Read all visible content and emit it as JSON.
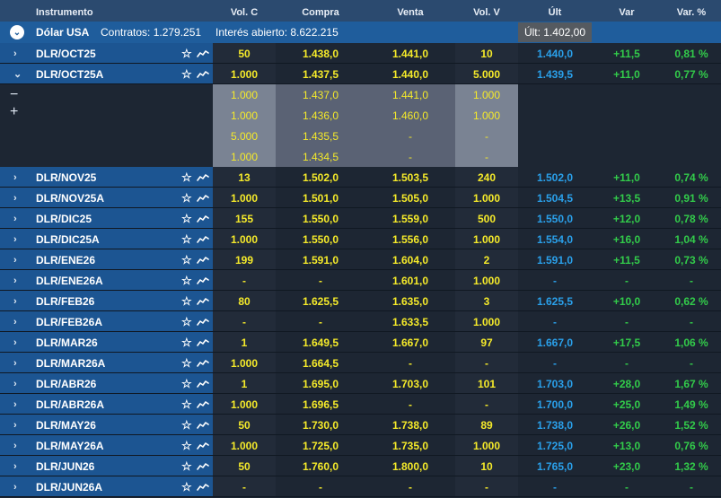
{
  "columns": {
    "instrument": "Instrumento",
    "vol_c": "Vol. C",
    "compra": "Compra",
    "venta": "Venta",
    "vol_v": "Vol. V",
    "ult": "Últ",
    "var": "Var",
    "var_pct": "Var. %"
  },
  "group": {
    "title": "Dólar USA",
    "contracts": "Contratos: 1.279.251",
    "open_interest": "Interés abierto: 8.622.215",
    "ult": "Últ: 1.402,00"
  },
  "icons": {
    "expand_group": "chevron-down-circle-icon",
    "row_expand": "chevron-right-icon",
    "row_collapse": "chevron-down-icon",
    "favorite": "star-icon",
    "chart": "trend-chart-icon",
    "depth_minus": "minus-icon",
    "depth_plus": "plus-icon"
  },
  "colors": {
    "header_bg": "#2b4a6f",
    "group_bg": "#1f5d9c",
    "row_bg": "#1c5592",
    "yellow": "#f5ea2a",
    "blue": "#2aa0ea",
    "green": "#32cb4a"
  },
  "rows_before_depth": [
    {
      "name": "DLR/OCT25",
      "chev": "›",
      "vol_c": "50",
      "compra": "1.438,0",
      "venta": "1.441,0",
      "vol_v": "10",
      "ult": "1.440,0",
      "var": "+11,5",
      "var_pct": "0,81 %"
    },
    {
      "name": "DLR/OCT25A",
      "chev": "⌄",
      "vol_c": "1.000",
      "compra": "1.437,5",
      "venta": "1.440,0",
      "vol_v": "5.000",
      "ult": "1.439,5",
      "var": "+11,0",
      "var_pct": "0,77 %"
    }
  ],
  "depth": {
    "minus": "−",
    "plus": "+",
    "rows": [
      {
        "vol_c": "1.000",
        "compra": "1.437,0",
        "venta": "1.441,0",
        "vol_v": "1.000"
      },
      {
        "vol_c": "1.000",
        "compra": "1.436,0",
        "venta": "1.460,0",
        "vol_v": "1.000"
      },
      {
        "vol_c": "5.000",
        "compra": "1.435,5",
        "venta": "-",
        "vol_v": "-"
      },
      {
        "vol_c": "1.000",
        "compra": "1.434,5",
        "venta": "-",
        "vol_v": "-"
      }
    ]
  },
  "rows_after_depth": [
    {
      "name": "DLR/NOV25",
      "chev": "›",
      "vol_c": "13",
      "compra": "1.502,0",
      "venta": "1.503,5",
      "vol_v": "240",
      "ult": "1.502,0",
      "var": "+11,0",
      "var_pct": "0,74 %"
    },
    {
      "name": "DLR/NOV25A",
      "chev": "›",
      "vol_c": "1.000",
      "compra": "1.501,0",
      "venta": "1.505,0",
      "vol_v": "1.000",
      "ult": "1.504,5",
      "var": "+13,5",
      "var_pct": "0,91 %"
    },
    {
      "name": "DLR/DIC25",
      "chev": "›",
      "vol_c": "155",
      "compra": "1.550,0",
      "venta": "1.559,0",
      "vol_v": "500",
      "ult": "1.550,0",
      "var": "+12,0",
      "var_pct": "0,78 %"
    },
    {
      "name": "DLR/DIC25A",
      "chev": "›",
      "vol_c": "1.000",
      "compra": "1.550,0",
      "venta": "1.556,0",
      "vol_v": "1.000",
      "ult": "1.554,0",
      "var": "+16,0",
      "var_pct": "1,04 %"
    },
    {
      "name": "DLR/ENE26",
      "chev": "›",
      "vol_c": "199",
      "compra": "1.591,0",
      "venta": "1.604,0",
      "vol_v": "2",
      "ult": "1.591,0",
      "var": "+11,5",
      "var_pct": "0,73 %"
    },
    {
      "name": "DLR/ENE26A",
      "chev": "›",
      "vol_c": "-",
      "compra": "-",
      "venta": "1.601,0",
      "vol_v": "1.000",
      "ult": "-",
      "var": "-",
      "var_pct": "-"
    },
    {
      "name": "DLR/FEB26",
      "chev": "›",
      "vol_c": "80",
      "compra": "1.625,5",
      "venta": "1.635,0",
      "vol_v": "3",
      "ult": "1.625,5",
      "var": "+10,0",
      "var_pct": "0,62 %"
    },
    {
      "name": "DLR/FEB26A",
      "chev": "›",
      "vol_c": "-",
      "compra": "-",
      "venta": "1.633,5",
      "vol_v": "1.000",
      "ult": "-",
      "var": "-",
      "var_pct": "-"
    },
    {
      "name": "DLR/MAR26",
      "chev": "›",
      "vol_c": "1",
      "compra": "1.649,5",
      "venta": "1.667,0",
      "vol_v": "97",
      "ult": "1.667,0",
      "var": "+17,5",
      "var_pct": "1,06 %"
    },
    {
      "name": "DLR/MAR26A",
      "chev": "›",
      "vol_c": "1.000",
      "compra": "1.664,5",
      "venta": "-",
      "vol_v": "-",
      "ult": "-",
      "var": "-",
      "var_pct": "-"
    },
    {
      "name": "DLR/ABR26",
      "chev": "›",
      "vol_c": "1",
      "compra": "1.695,0",
      "venta": "1.703,0",
      "vol_v": "101",
      "ult": "1.703,0",
      "var": "+28,0",
      "var_pct": "1,67 %"
    },
    {
      "name": "DLR/ABR26A",
      "chev": "›",
      "vol_c": "1.000",
      "compra": "1.696,5",
      "venta": "-",
      "vol_v": "-",
      "ult": "1.700,0",
      "var": "+25,0",
      "var_pct": "1,49 %"
    },
    {
      "name": "DLR/MAY26",
      "chev": "›",
      "vol_c": "50",
      "compra": "1.730,0",
      "venta": "1.738,0",
      "vol_v": "89",
      "ult": "1.738,0",
      "var": "+26,0",
      "var_pct": "1,52 %"
    },
    {
      "name": "DLR/MAY26A",
      "chev": "›",
      "vol_c": "1.000",
      "compra": "1.725,0",
      "venta": "1.735,0",
      "vol_v": "1.000",
      "ult": "1.725,0",
      "var": "+13,0",
      "var_pct": "0,76 %"
    },
    {
      "name": "DLR/JUN26",
      "chev": "›",
      "vol_c": "50",
      "compra": "1.760,0",
      "venta": "1.800,0",
      "vol_v": "10",
      "ult": "1.765,0",
      "var": "+23,0",
      "var_pct": "1,32 %"
    },
    {
      "name": "DLR/JUN26A",
      "chev": "›",
      "vol_c": "-",
      "compra": "-",
      "venta": "-",
      "vol_v": "-",
      "ult": "-",
      "var": "-",
      "var_pct": "-"
    }
  ]
}
